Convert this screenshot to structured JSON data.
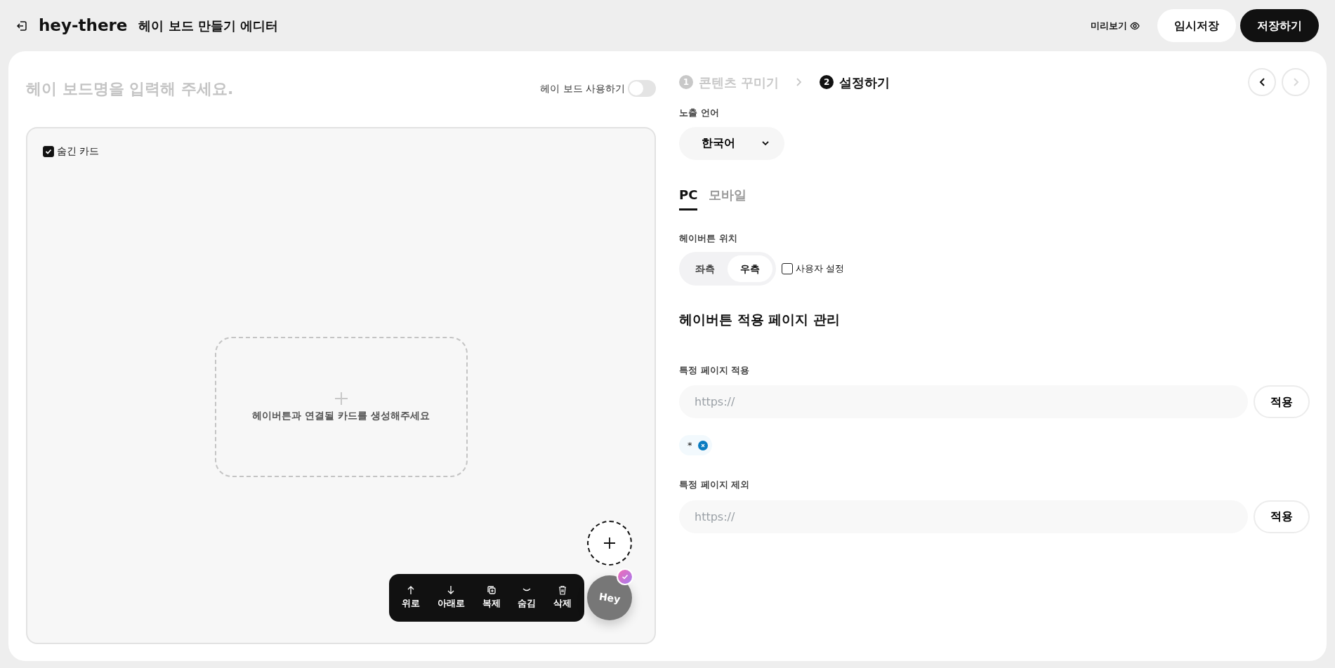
{
  "header": {
    "title": "hey-there",
    "subtitle": "헤이 보드 만들기 에디터",
    "preview": "미리보기",
    "buttons": [
      {
        "label": "임시저장",
        "kind": "secondary"
      },
      {
        "label": "저장하기",
        "kind": "primary"
      }
    ]
  },
  "board": {
    "name_placeholder": "헤이 보드명을 입력해 주세요.",
    "use_toggle": {
      "label": "헤이 보드 사용하기",
      "on": false
    },
    "hidden_card": {
      "label": "숨긴 카드",
      "checked": true
    },
    "empty_card_text": "헤이버튼과 연결될 카드를 생성해주세요",
    "toolbar": [
      {
        "label": "위로",
        "kind": "up"
      },
      {
        "label": "아래로",
        "kind": "down"
      },
      {
        "label": "복제",
        "kind": "copy"
      },
      {
        "label": "숨김",
        "kind": "hide"
      },
      {
        "label": "삭제",
        "kind": "delete"
      }
    ],
    "hey_button": {
      "label": "Hey",
      "checked": true
    }
  },
  "steps": [
    {
      "number": "1",
      "label": "콘텐츠 꾸미기",
      "selected": false
    },
    {
      "number": "2",
      "label": "설정하기",
      "selected": true
    }
  ],
  "step_nav": [
    {
      "kind": "prev",
      "disabled": false
    },
    {
      "kind": "next",
      "disabled": true
    }
  ],
  "language": {
    "label": "노출 언어",
    "value": "한국어"
  },
  "device_tabs": [
    {
      "label": "PC",
      "selected": true
    },
    {
      "label": "모바일",
      "selected": false
    }
  ],
  "position": {
    "label": "헤이버튼 위치",
    "options": [
      {
        "label": "좌측",
        "selected": false
      },
      {
        "label": "우측",
        "selected": true
      }
    ],
    "custom": {
      "label": "사용자 설정",
      "checked": false
    }
  },
  "pages": {
    "title": "헤이버튼 적용 페이지 관리",
    "include": {
      "label": "특정 페이지 적용",
      "placeholder": "https://",
      "button": "적용",
      "tags": [
        "*"
      ]
    },
    "exclude": {
      "label": "특정 페이지 제외",
      "placeholder": "https://",
      "button": "적용"
    }
  }
}
